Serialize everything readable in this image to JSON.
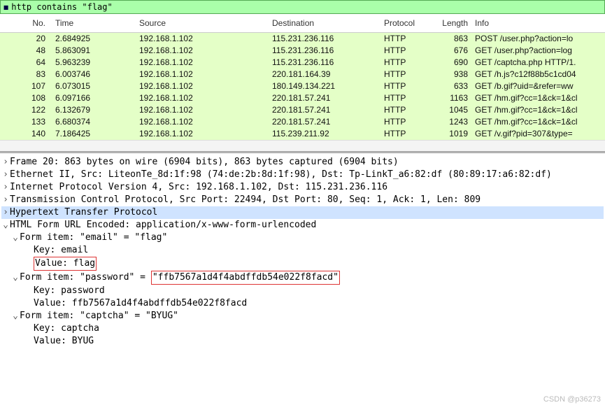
{
  "filter": {
    "value": "http contains \"flag\""
  },
  "cols": {
    "no": "No.",
    "time": "Time",
    "src": "Source",
    "dst": "Destination",
    "proto": "Protocol",
    "len": "Length",
    "info": "Info"
  },
  "rows": [
    {
      "no": "20",
      "time": "2.684925",
      "src": "192.168.1.102",
      "dst": "115.231.236.116",
      "proto": "HTTP",
      "len": "863",
      "info": "POST /user.php?action=lo"
    },
    {
      "no": "48",
      "time": "5.863091",
      "src": "192.168.1.102",
      "dst": "115.231.236.116",
      "proto": "HTTP",
      "len": "676",
      "info": "GET /user.php?action=log"
    },
    {
      "no": "64",
      "time": "5.963239",
      "src": "192.168.1.102",
      "dst": "115.231.236.116",
      "proto": "HTTP",
      "len": "690",
      "info": "GET /captcha.php HTTP/1."
    },
    {
      "no": "83",
      "time": "6.003746",
      "src": "192.168.1.102",
      "dst": "220.181.164.39",
      "proto": "HTTP",
      "len": "938",
      "info": "GET /h.js?c12f88b5c1cd04"
    },
    {
      "no": "107",
      "time": "6.073015",
      "src": "192.168.1.102",
      "dst": "180.149.134.221",
      "proto": "HTTP",
      "len": "633",
      "info": "GET /b.gif?uid=&refer=ww"
    },
    {
      "no": "108",
      "time": "6.097166",
      "src": "192.168.1.102",
      "dst": "220.181.57.241",
      "proto": "HTTP",
      "len": "1163",
      "info": "GET /hm.gif?cc=1&ck=1&cl"
    },
    {
      "no": "122",
      "time": "6.132679",
      "src": "192.168.1.102",
      "dst": "220.181.57.241",
      "proto": "HTTP",
      "len": "1045",
      "info": "GET /hm.gif?cc=1&ck=1&cl"
    },
    {
      "no": "133",
      "time": "6.680374",
      "src": "192.168.1.102",
      "dst": "220.181.57.241",
      "proto": "HTTP",
      "len": "1243",
      "info": "GET /hm.gif?cc=1&ck=1&cl"
    },
    {
      "no": "140",
      "time": "7.186425",
      "src": "192.168.1.102",
      "dst": "115.239.211.92",
      "proto": "HTTP",
      "len": "1019",
      "info": "GET /v.gif?pid=307&type="
    }
  ],
  "tree": {
    "frame": "Frame 20: 863 bytes on wire (6904 bits), 863 bytes captured (6904 bits)",
    "eth": "Ethernet II, Src: LiteonTe_8d:1f:98 (74:de:2b:8d:1f:98), Dst: Tp-LinkT_a6:82:df (80:89:17:a6:82:df)",
    "ip": "Internet Protocol Version 4, Src: 192.168.1.102, Dst: 115.231.236.116",
    "tcp": "Transmission Control Protocol, Src Port: 22494, Dst Port: 80, Seq: 1, Ack: 1, Len: 809",
    "http": "Hypertext Transfer Protocol",
    "formhdr": "HTML Form URL Encoded: application/x-www-form-urlencoded",
    "email_item": "Form item: \"email\" = \"flag\"",
    "email_key": "Key: email",
    "email_val": "Value: flag",
    "pw_item_pre": "Form item: \"password\" = ",
    "pw_item_val": "\"ffb7567a1d4f4abdffdb54e022f8facd\"",
    "pw_key": "Key: password",
    "pw_val": "Value: ffb7567a1d4f4abdffdb54e022f8facd",
    "cap_item": "Form item: \"captcha\" = \"BYUG\"",
    "cap_key": "Key: captcha",
    "cap_val": "Value: BYUG"
  },
  "watermark": "CSDN @p36273"
}
